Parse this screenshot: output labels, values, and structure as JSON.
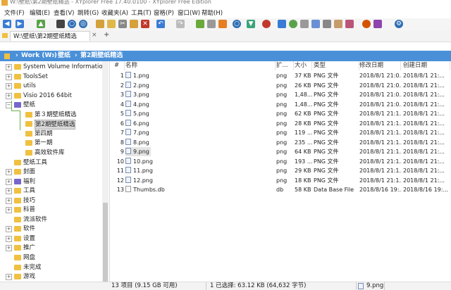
{
  "window": {
    "title": "W:\\壁纸\\第2期壁纸精选 - XYplorer Free 17.40.0100 - XYplorer Free Edition"
  },
  "menu": [
    "文件(F)",
    "编辑(E)",
    "查看(V)",
    "跳转(G)",
    "收藏夹(A)",
    "工具(T)",
    "窗格(P)",
    "窗口(W)",
    "帮助(H)"
  ],
  "tab": {
    "label": "W:\\壁纸\\第2期壁纸精选",
    "add": "+"
  },
  "breadcrumb": [
    "Work (W:)",
    "壁纸",
    "第2期壁纸精选"
  ],
  "tree": [
    {
      "label": "System Volume Information",
      "indent": 1,
      "exp": "+",
      "color": "yellow"
    },
    {
      "label": "ToolsSet",
      "indent": 1,
      "exp": "+",
      "color": "yellow"
    },
    {
      "label": "utils",
      "indent": 1,
      "exp": "+",
      "color": "yellow"
    },
    {
      "label": "Visio 2016 64bit",
      "indent": 1,
      "exp": "+",
      "color": "yellow"
    },
    {
      "label": "壁纸",
      "indent": 1,
      "exp": "−",
      "color": "purple"
    },
    {
      "label": "第３期壁纸精选",
      "indent": 2,
      "exp": "",
      "color": "yellow"
    },
    {
      "label": "第2期壁纸精选",
      "indent": 2,
      "exp": "",
      "color": "yellow",
      "selected": true
    },
    {
      "label": "第四期",
      "indent": 2,
      "exp": "",
      "color": "yellow"
    },
    {
      "label": "第一期",
      "indent": 2,
      "exp": "",
      "color": "yellow"
    },
    {
      "label": "高效软件库",
      "indent": 2,
      "exp": "",
      "color": "yellow"
    },
    {
      "label": "壁纸工具",
      "indent": 1,
      "exp": "",
      "color": "yellow"
    },
    {
      "label": "封面",
      "indent": 1,
      "exp": "+",
      "color": "yellow"
    },
    {
      "label": "福利",
      "indent": 1,
      "exp": "+",
      "color": "purple"
    },
    {
      "label": "工具",
      "indent": 1,
      "exp": "+",
      "color": "yellow"
    },
    {
      "label": "技巧",
      "indent": 1,
      "exp": "+",
      "color": "yellow"
    },
    {
      "label": "科普",
      "indent": 1,
      "exp": "+",
      "color": "yellow"
    },
    {
      "label": "流派软件",
      "indent": 1,
      "exp": "",
      "color": "yellow"
    },
    {
      "label": "软件",
      "indent": 1,
      "exp": "+",
      "color": "yellow"
    },
    {
      "label": "设置",
      "indent": 1,
      "exp": "+",
      "color": "yellow"
    },
    {
      "label": "推广",
      "indent": 1,
      "exp": "+",
      "color": "yellow"
    },
    {
      "label": "网盘",
      "indent": 1,
      "exp": "",
      "color": "yellow"
    },
    {
      "label": "未完成",
      "indent": 1,
      "exp": "",
      "color": "yellow"
    },
    {
      "label": "游戏",
      "indent": 1,
      "exp": "+",
      "color": "yellow"
    }
  ],
  "columns": {
    "num": "#",
    "name": "名称",
    "ext": "扩...",
    "size": "大小",
    "type": "类型",
    "modified": "修改日期",
    "created": "创建日期"
  },
  "files": [
    {
      "num": "1",
      "name": "1.png",
      "ext": "png",
      "size": "37 KB",
      "type": "PNG 文件",
      "modified": "2018/8/1 21:0...",
      "created": "2018/8/1 21:..."
    },
    {
      "num": "2",
      "name": "2.png",
      "ext": "png",
      "size": "26 KB",
      "type": "PNG 文件",
      "modified": "2018/8/1 21:0...",
      "created": "2018/8/1 21:..."
    },
    {
      "num": "3",
      "name": "3.png",
      "ext": "png",
      "size": "1,48...",
      "type": "PNG 文件",
      "modified": "2018/8/1 21:0...",
      "created": "2018/8/1 21:..."
    },
    {
      "num": "4",
      "name": "4.png",
      "ext": "png",
      "size": "1,48...",
      "type": "PNG 文件",
      "modified": "2018/8/1 21:0...",
      "created": "2018/8/1 21:..."
    },
    {
      "num": "5",
      "name": "5.png",
      "ext": "png",
      "size": "62 KB",
      "type": "PNG 文件",
      "modified": "2018/8/1 21:1...",
      "created": "2018/8/1 21:..."
    },
    {
      "num": "6",
      "name": "6.png",
      "ext": "png",
      "size": "28 KB",
      "type": "PNG 文件",
      "modified": "2018/8/1 21:1...",
      "created": "2018/8/1 21:..."
    },
    {
      "num": "7",
      "name": "7.png",
      "ext": "png",
      "size": "119 ...",
      "type": "PNG 文件",
      "modified": "2018/8/1 21:1...",
      "created": "2018/8/1 21:..."
    },
    {
      "num": "8",
      "name": "8.png",
      "ext": "png",
      "size": "235 ...",
      "type": "PNG 文件",
      "modified": "2018/8/1 21:1...",
      "created": "2018/8/1 21:..."
    },
    {
      "num": "9",
      "name": "9.png",
      "ext": "png",
      "size": "64 KB",
      "type": "PNG 文件",
      "modified": "2018/8/1 21:1...",
      "created": "2018/8/1 21:...",
      "selected": true
    },
    {
      "num": "10",
      "name": "10.png",
      "ext": "png",
      "size": "193 ...",
      "type": "PNG 文件",
      "modified": "2018/8/1 21:1...",
      "created": "2018/8/1 21:..."
    },
    {
      "num": "11",
      "name": "11.png",
      "ext": "png",
      "size": "29 KB",
      "type": "PNG 文件",
      "modified": "2018/8/1 21:1...",
      "created": "2018/8/1 21:..."
    },
    {
      "num": "12",
      "name": "12.png",
      "ext": "png",
      "size": "18 KB",
      "type": "PNG 文件",
      "modified": "2018/8/1 21:1...",
      "created": "2018/8/1 21:..."
    },
    {
      "num": "13",
      "name": "Thumbs.db",
      "ext": "db",
      "size": "58 KB",
      "type": "Data Base File",
      "modified": "2018/8/16 19:...",
      "created": "2018/8/16 19:...",
      "db": true
    }
  ],
  "status": {
    "count": "13 项目 (9.15 GB 可用)",
    "selection": "1 已选择: 63.12 KB (64,632 字节)",
    "selected_file": "9.png"
  },
  "colors": {
    "accent": "#4a90d9",
    "folder": "#f0c040",
    "tree_line": "#6ab04c"
  }
}
